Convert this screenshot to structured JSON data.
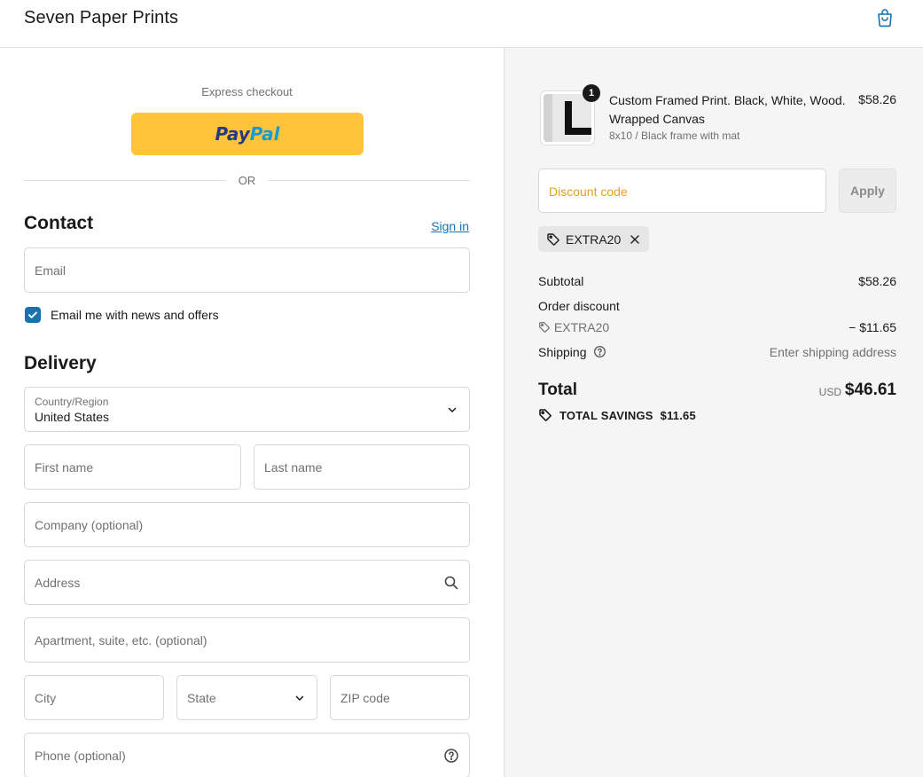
{
  "header": {
    "brand": "Seven Paper Prints",
    "cart_icon": "shopping-bag-icon"
  },
  "express": {
    "label": "Express checkout",
    "paypal_a": "Pay",
    "paypal_b": "Pal",
    "or": "OR"
  },
  "contact": {
    "title": "Contact",
    "sign_in": "Sign in",
    "email_placeholder": "Email",
    "news_label": "Email me with news and offers",
    "news_checked": true
  },
  "delivery": {
    "title": "Delivery",
    "country_label": "Country/Region",
    "country_value": "United States",
    "first_name": "First name",
    "last_name": "Last name",
    "company": "Company (optional)",
    "address": "Address",
    "apartment": "Apartment, suite, etc. (optional)",
    "city": "City",
    "state": "State",
    "zip": "ZIP code",
    "phone": "Phone (optional)"
  },
  "summary": {
    "item": {
      "quantity": "1",
      "title": "Custom Framed Print. Black, White, Wood. Wrapped Canvas",
      "variant": "8x10 / Black frame with mat",
      "price": "$58.26"
    },
    "discount_placeholder": "Discount code",
    "apply_label": "Apply",
    "applied_code": "EXTRA20",
    "subtotal_label": "Subtotal",
    "subtotal_value": "$58.26",
    "order_discount_label": "Order discount",
    "discount_code": "EXTRA20",
    "discount_value": "− $11.65",
    "shipping_label": "Shipping",
    "shipping_value": "Enter shipping address",
    "total_label": "Total",
    "total_currency": "USD",
    "total_value": "$46.61",
    "savings_label": "TOTAL SAVINGS",
    "savings_value": "$11.65"
  },
  "colors": {
    "accent": "#1773b0",
    "paypal_yellow": "#ffc439",
    "paypal_dark": "#253b80",
    "paypal_light": "#179bd7",
    "discount_placeholder": "#e0a21e"
  }
}
